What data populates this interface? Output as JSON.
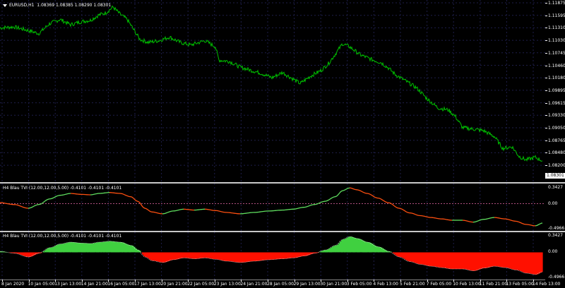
{
  "main": {
    "symbol": "EURUSD,H1",
    "ohlc": "1.08369 1.08385 1.08290 1.08301",
    "current_price": "1.08301",
    "price_labels": [
      "1.11875",
      "1.11595",
      "1.11310",
      "1.11030",
      "1.10745",
      "1.10460",
      "1.10180",
      "1.09895",
      "1.09615",
      "1.09330",
      "1.09050",
      "1.08765",
      "1.08480",
      "1.08200"
    ],
    "line_color": "#00c000"
  },
  "ind1": {
    "title": "H4 Blau TVI (12.00,12.00,5.00) -0.4101 -0.4101 -0.4101",
    "labels": {
      "top": "0.3427",
      "zero": "0.00",
      "bottom": "-0.4966"
    },
    "up_color": "#60e060",
    "down_color": "#ff5010"
  },
  "ind2": {
    "title": "H4 Blau TVI (12.00,12.00,5.00) -0.4101 -0.4101 -0.4101",
    "labels": {
      "top": "0.3427",
      "zero": "0.00",
      "bottom": "-0.4966"
    },
    "pos_color": "#40d040",
    "neg_color": "#ff1000"
  },
  "time_labels": [
    "8 Jan 2020",
    "10 Jan 05:00",
    "13 Jan 13:00",
    "14 Jan 21:00",
    "16 Jan 05:00",
    "17 Jan 13:00",
    "20 Jan 21:00",
    "22 Jan 05:00",
    "23 Jan 13:00",
    "24 Jan 21:00",
    "28 Jan 05:00",
    "29 Jan 13:00",
    "30 Jan 21:00",
    "3 Feb 05:00",
    "4 Feb 13:00",
    "5 Feb 21:00",
    "7 Feb 05:00",
    "10 Feb 13:00",
    "11 Feb 21:00",
    "13 Feb 05:00",
    "14 Feb 13:00"
  ],
  "price_path": [
    [
      0,
      1.1131
    ],
    [
      20,
      1.1133
    ],
    [
      40,
      1.1125
    ],
    [
      55,
      1.1118
    ],
    [
      70,
      1.114
    ],
    [
      85,
      1.115
    ],
    [
      100,
      1.1138
    ],
    [
      115,
      1.1145
    ],
    [
      128,
      1.1148
    ],
    [
      140,
      1.116
    ],
    [
      150,
      1.1165
    ],
    [
      160,
      1.1178
    ],
    [
      170,
      1.1162
    ],
    [
      180,
      1.115
    ],
    [
      190,
      1.1125
    ],
    [
      198,
      1.1105
    ],
    [
      210,
      1.1098
    ],
    [
      225,
      1.1102
    ],
    [
      240,
      1.111
    ],
    [
      255,
      1.1098
    ],
    [
      270,
      1.1092
    ],
    [
      290,
      1.1102
    ],
    [
      305,
      1.1088
    ],
    [
      310,
      1.1058
    ],
    [
      325,
      1.1055
    ],
    [
      340,
      1.1042
    ],
    [
      355,
      1.1035
    ],
    [
      370,
      1.1028
    ],
    [
      385,
      1.1018
    ],
    [
      400,
      1.103
    ],
    [
      415,
      1.1015
    ],
    [
      425,
      1.1005
    ],
    [
      440,
      1.1022
    ],
    [
      455,
      1.1035
    ],
    [
      465,
      1.105
    ],
    [
      475,
      1.1072
    ],
    [
      485,
      1.1095
    ],
    [
      495,
      1.1088
    ],
    [
      510,
      1.107
    ],
    [
      525,
      1.106
    ],
    [
      540,
      1.1052
    ],
    [
      550,
      1.104
    ],
    [
      560,
      1.1025
    ],
    [
      575,
      1.101
    ],
    [
      590,
      1.0995
    ],
    [
      605,
      1.097
    ],
    [
      620,
      1.095
    ],
    [
      635,
      1.0945
    ],
    [
      645,
      1.093
    ],
    [
      655,
      1.0905
    ],
    [
      670,
      1.0902
    ],
    [
      685,
      1.0898
    ],
    [
      700,
      1.0885
    ],
    [
      712,
      1.0858
    ],
    [
      725,
      1.0862
    ],
    [
      735,
      1.084
    ],
    [
      745,
      1.0832
    ],
    [
      758,
      1.0838
    ],
    [
      768,
      1.083
    ]
  ],
  "tvi_path": [
    [
      0,
      0.02
    ],
    [
      20,
      -0.02
    ],
    [
      40,
      -0.1
    ],
    [
      55,
      -0.02
    ],
    [
      70,
      0.1
    ],
    [
      85,
      0.18
    ],
    [
      100,
      0.22
    ],
    [
      115,
      0.2
    ],
    [
      128,
      0.19
    ],
    [
      140,
      0.22
    ],
    [
      155,
      0.24
    ],
    [
      170,
      0.22
    ],
    [
      185,
      0.15
    ],
    [
      195,
      0.05
    ],
    [
      205,
      -0.1
    ],
    [
      215,
      -0.18
    ],
    [
      230,
      -0.22
    ],
    [
      245,
      -0.16
    ],
    [
      260,
      -0.12
    ],
    [
      275,
      -0.14
    ],
    [
      290,
      -0.12
    ],
    [
      305,
      -0.15
    ],
    [
      320,
      -0.19
    ],
    [
      340,
      -0.22
    ],
    [
      360,
      -0.19
    ],
    [
      380,
      -0.16
    ],
    [
      400,
      -0.14
    ],
    [
      415,
      -0.12
    ],
    [
      430,
      -0.08
    ],
    [
      445,
      -0.02
    ],
    [
      460,
      0.05
    ],
    [
      475,
      0.15
    ],
    [
      485,
      0.28
    ],
    [
      495,
      0.34
    ],
    [
      505,
      0.3
    ],
    [
      520,
      0.22
    ],
    [
      535,
      0.12
    ],
    [
      550,
      0.02
    ],
    [
      565,
      -0.1
    ],
    [
      580,
      -0.2
    ],
    [
      595,
      -0.26
    ],
    [
      610,
      -0.3
    ],
    [
      625,
      -0.33
    ],
    [
      640,
      -0.36
    ],
    [
      655,
      -0.36
    ],
    [
      670,
      -0.4
    ],
    [
      685,
      -0.34
    ],
    [
      700,
      -0.3
    ],
    [
      715,
      -0.33
    ],
    [
      730,
      -0.38
    ],
    [
      745,
      -0.45
    ],
    [
      758,
      -0.48
    ],
    [
      768,
      -0.42
    ]
  ]
}
